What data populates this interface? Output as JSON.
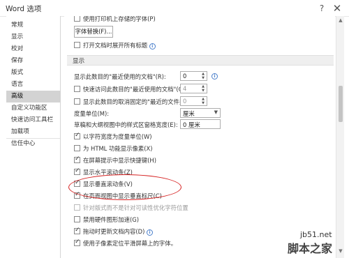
{
  "window": {
    "title": "Word 选项",
    "help_glyph": "?",
    "close_glyph": "✕"
  },
  "nav": {
    "items": [
      {
        "label": "常规"
      },
      {
        "label": "显示"
      },
      {
        "label": "校对"
      },
      {
        "label": "保存"
      },
      {
        "label": "版式"
      },
      {
        "label": "语言"
      },
      {
        "label": "高级",
        "selected": true
      },
      {
        "label": "自定义功能区"
      },
      {
        "label": "快速访问工具栏"
      },
      {
        "label": "加载项"
      },
      {
        "label": "信任中心"
      }
    ]
  },
  "advanced": {
    "top_partial": "使用打印机上存储的字体(P)",
    "font_substitution_button": "字体替换(F)...",
    "expand_headings": "打开文档时展开所有标题",
    "display_section": "显示",
    "recent_docs_label": "显示此数目的\"最近使用的文档\"(R):",
    "recent_docs_value": "0",
    "quick_access_label": "快速访问此数目的\"最近使用的文档\"(Q):",
    "quick_access_value": "4",
    "unpinned_folders_label": "显示此数目的取消固定的\"最近的文件夹\"(F):",
    "unpinned_folders_value": "0",
    "units_label": "度量单位(M):",
    "units_value": "厘米",
    "style_pane_label": "草稿和大纲视图中的样式区窗格宽度(E):",
    "style_pane_value": "0 厘米",
    "options": [
      {
        "label": "以字符宽度为度量单位(W)",
        "checked": true
      },
      {
        "label": "为 HTML 功能显示像素(X)",
        "checked": false
      },
      {
        "label": "在屏幕提示中显示快捷键(H)",
        "checked": true
      },
      {
        "label": "显示水平滚动条(Z)",
        "checked": true
      },
      {
        "label": "显示垂直滚动条(V)",
        "checked": true
      },
      {
        "label": "在页面视图中显示垂直标尺(C)",
        "checked": true
      },
      {
        "label": "针对版式而不是针对可读性优化字符位置",
        "checked": false,
        "disabled": true
      },
      {
        "label": "禁用硬件图形加速(G)",
        "checked": false
      },
      {
        "label": "拖动时更新文档内容(D)",
        "checked": true
      },
      {
        "label": "使用子像素定位平滑屏幕上的字体。",
        "checked": true
      }
    ]
  },
  "watermark": {
    "url": "jb51.net",
    "brand": "脚本之家"
  },
  "colors": {
    "highlight": "#d62121",
    "selected_nav": "#d3d3d3",
    "info": "#4a7fcb"
  }
}
